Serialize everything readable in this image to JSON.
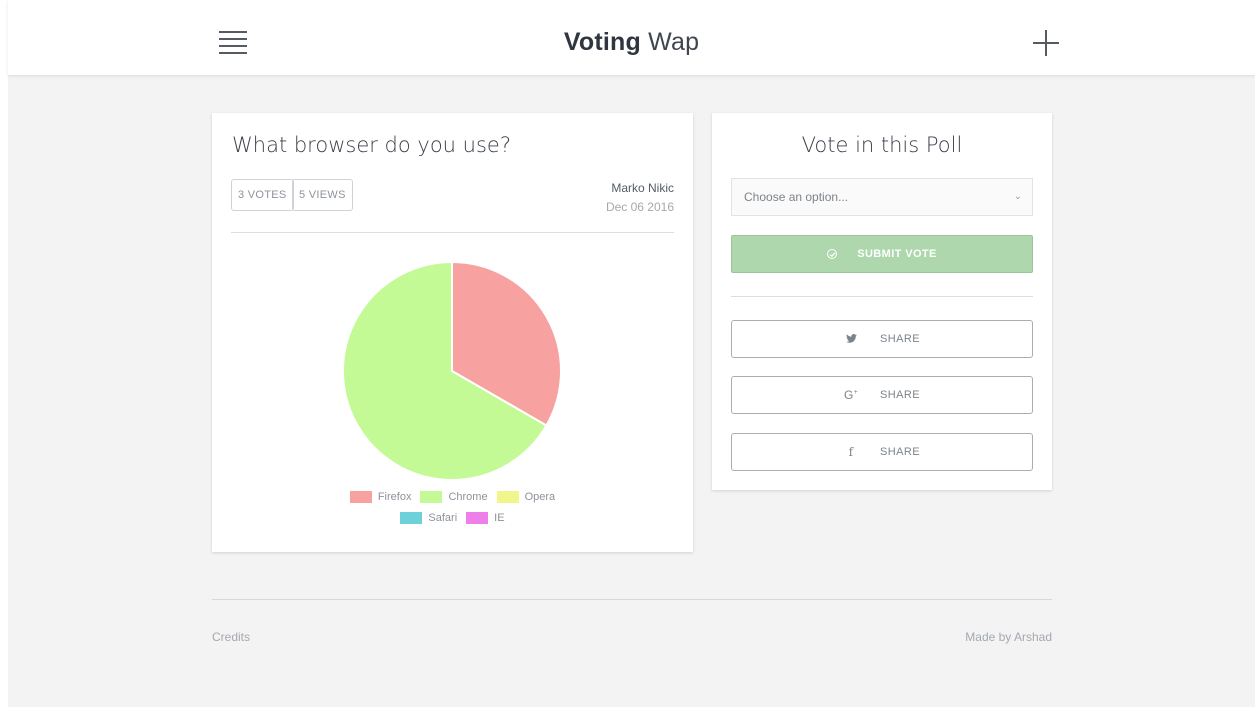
{
  "header": {
    "brand_bold": "Voting",
    "brand_light": "Wap"
  },
  "poll": {
    "question": "What browser do you use?",
    "votes_badge": "3 VOTES",
    "views_badge": "5 VIEWS",
    "author": "Marko Nikic",
    "date": "Dec 06 2016"
  },
  "chart_data": {
    "type": "pie",
    "categories": [
      "Firefox",
      "Chrome",
      "Opera",
      "Safari",
      "IE"
    ],
    "values": [
      1,
      2,
      0,
      0,
      0
    ],
    "colors": [
      "#f7a1a1",
      "#c4fa96",
      "#f2f58a",
      "#6ed0d8",
      "#ee7fe9"
    ],
    "legend_position": "bottom"
  },
  "vote": {
    "title": "Vote in this Poll",
    "select_placeholder": "Choose an option...",
    "submit_label": "SUBMIT VOTE",
    "share_label": "SHARE",
    "accent_color": "#aed7ad"
  },
  "footer": {
    "credits": "Credits",
    "made_by": "Made by Arshad"
  }
}
